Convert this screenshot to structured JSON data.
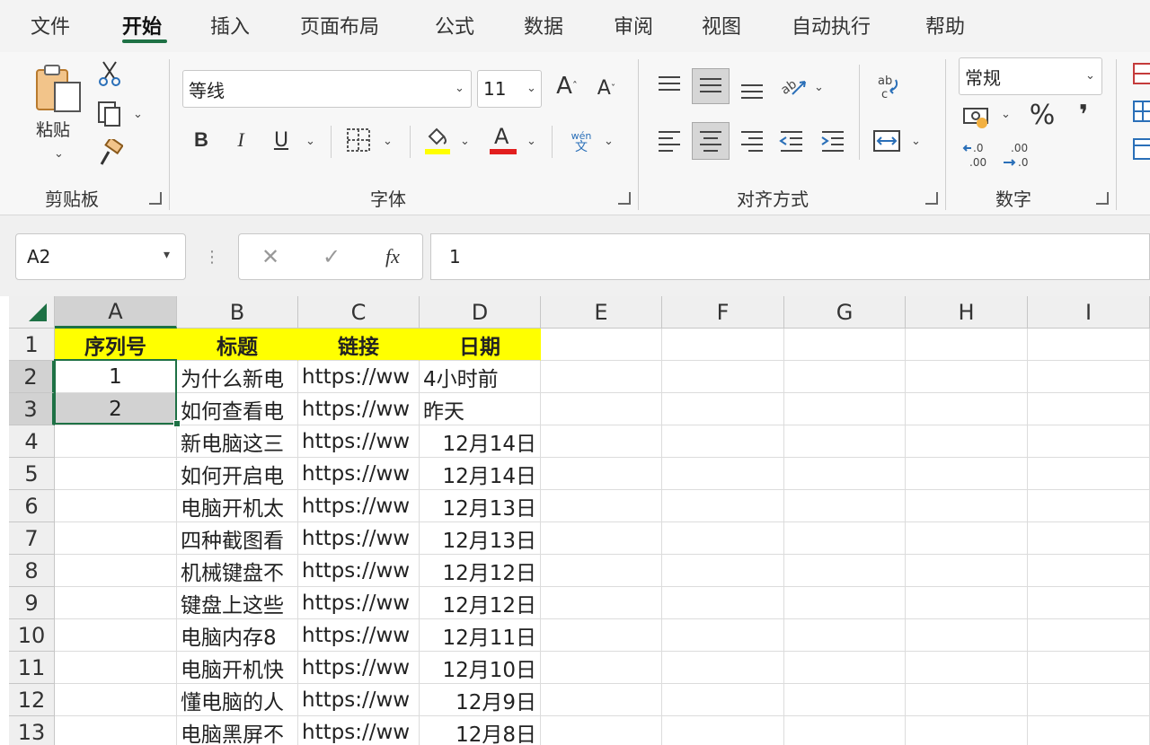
{
  "tabs": [
    "文件",
    "开始",
    "插入",
    "页面布局",
    "公式",
    "数据",
    "审阅",
    "视图",
    "自动执行",
    "帮助"
  ],
  "active_tab": "开始",
  "ribbon": {
    "clipboard": {
      "paste_label": "粘贴",
      "group_label": "剪贴板"
    },
    "font": {
      "font_name": "等线",
      "font_size": "11",
      "group_label": "字体",
      "wen_label": "wén"
    },
    "alignment": {
      "group_label": "对齐方式"
    },
    "number": {
      "format": "常规",
      "group_label": "数字",
      "percent": "%",
      "comma": "❜"
    }
  },
  "formula_bar": {
    "name_box": "A2",
    "fx": "fx",
    "content": "1"
  },
  "grid": {
    "columns": [
      "A",
      "B",
      "C",
      "D",
      "E",
      "F",
      "G",
      "H",
      "I"
    ],
    "rows": [
      "1",
      "2",
      "3",
      "4",
      "5",
      "6",
      "7",
      "8",
      "9",
      "10",
      "11",
      "12",
      "13"
    ],
    "header_row": [
      "序列号",
      "标题",
      "链接",
      "日期"
    ],
    "data": [
      [
        "1",
        "为什么新电",
        "https://ww",
        "4小时前"
      ],
      [
        "2",
        "如何查看电",
        "https://ww",
        "昨天"
      ],
      [
        "",
        "新电脑这三",
        "https://ww",
        "12月14日"
      ],
      [
        "",
        "如何开启电",
        "https://ww",
        "12月14日"
      ],
      [
        "",
        "电脑开机太",
        "https://ww",
        "12月13日"
      ],
      [
        "",
        "四种截图看",
        "https://ww",
        "12月13日"
      ],
      [
        "",
        "机械键盘不",
        "https://ww",
        "12月12日"
      ],
      [
        "",
        "键盘上这些",
        "https://ww",
        "12月12日"
      ],
      [
        "",
        "电脑内存8",
        "https://ww",
        "12月11日"
      ],
      [
        "",
        "电脑开机快",
        "https://ww",
        "12月10日"
      ],
      [
        "",
        "懂电脑的人",
        "https://ww",
        "12月9日"
      ],
      [
        "",
        "电脑黑屏不",
        "https://ww",
        "12月8日"
      ]
    ]
  },
  "colors": {
    "accent": "#1e7145",
    "header_fill": "#ffff00",
    "selection_tint": "#d2d2d2"
  }
}
